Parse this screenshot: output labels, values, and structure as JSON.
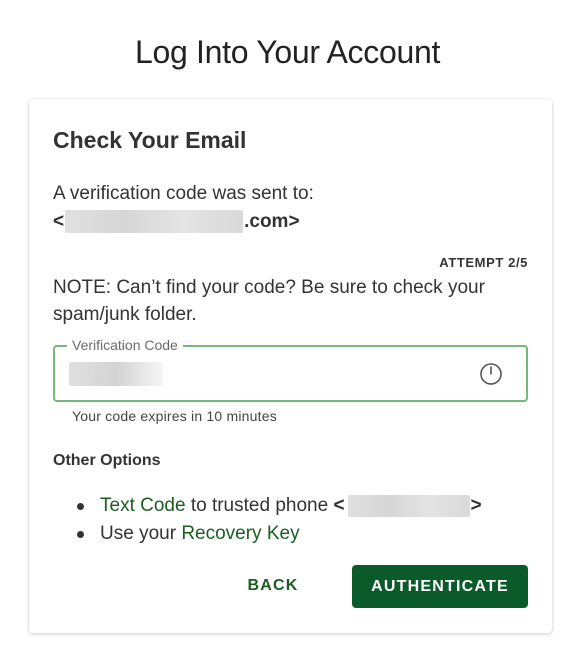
{
  "page": {
    "title": "Log Into Your Account"
  },
  "card": {
    "heading": "Check Your Email",
    "sent_text": "A verification code was sent to:",
    "email_prefix": "<",
    "email_suffix": ".com>",
    "attempt": "ATTEMPT 2/5",
    "note": "NOTE: Can’t find your code? Be sure to check your spam/junk folder."
  },
  "code_field": {
    "label": "Verification Code",
    "value": "",
    "helper": "Your code expires in 10 minutes",
    "icon": "timer-icon"
  },
  "other_options": {
    "heading": "Other Options",
    "text_code": {
      "link": "Text Code",
      "text": "to trusted phone",
      "prefix": "<",
      "suffix": ">"
    },
    "recovery": {
      "text": "Use your",
      "link": "Recovery Key"
    }
  },
  "actions": {
    "back_label": "BACK",
    "authenticate_label": "AUTHENTICATE"
  },
  "colors": {
    "accent": "#0b5a2a",
    "link": "#1b5e20",
    "field_border": "#78b87a"
  }
}
